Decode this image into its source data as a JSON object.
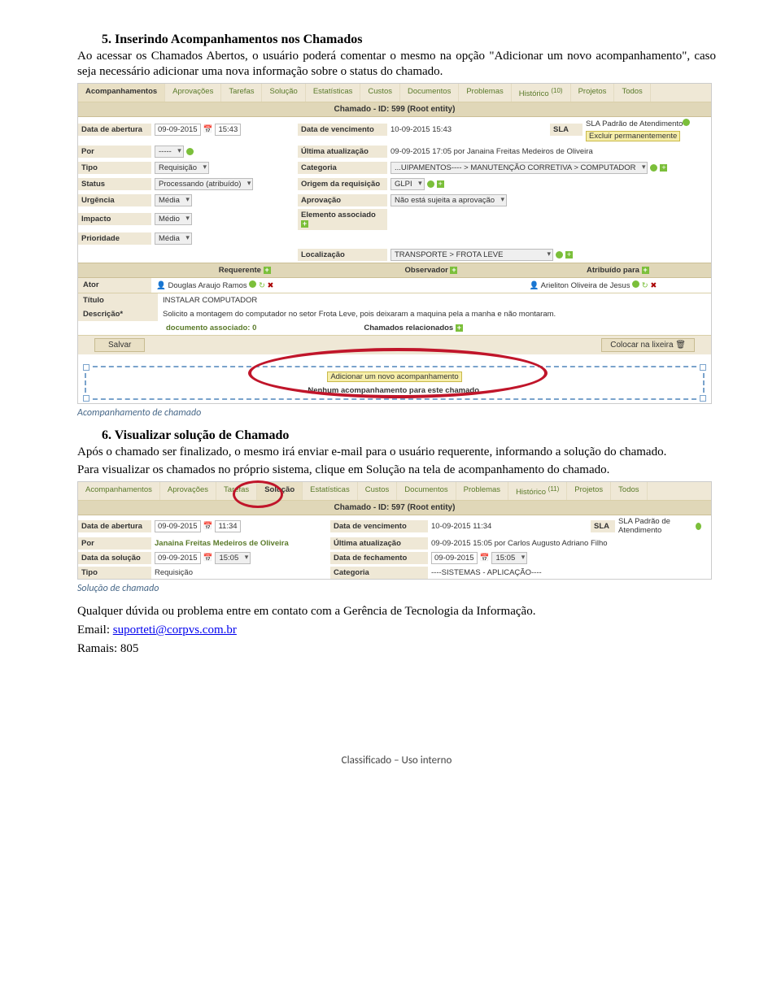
{
  "section5": {
    "heading": "5. Inserindo Acompanhamentos nos Chamados",
    "para": "Ao acessar os Chamados Abertos, o usuário poderá comentar o mesmo na opção \"Adicionar um novo acompanhamento\", caso seja necessário adicionar uma nova informação sobre o status do chamado."
  },
  "shot1": {
    "tabs": [
      "Acompanhamentos",
      "Aprovações",
      "Tarefas",
      "Solução",
      "Estatísticas",
      "Custos",
      "Documentos",
      "Problemas",
      "Histórico",
      "Projetos",
      "Todos"
    ],
    "tabs_active_index": 0,
    "historico_count": "(10)",
    "header": "Chamado - ID: 599 (Root entity)",
    "r1": {
      "l1": "Data de abertura",
      "v1_date": "09-09-2015",
      "v1_time": "15:43",
      "l2": "Data de vencimento",
      "v2": "10-09-2015 15:43",
      "l3": "SLA",
      "v3a": "SLA Padrão de Atendimento",
      "v3b": "Excluir permanentemente"
    },
    "r2": {
      "l1": "Por",
      "v1": "-----",
      "l2": "Última atualização",
      "v2": "09-09-2015 17:05 por Janaina Freitas Medeiros de Oliveira"
    },
    "r3": {
      "l1": "Tipo",
      "v1": "Requisição",
      "l2": "Categoria",
      "v2": "...UIPAMENTOS---- > MANUTENÇÃO CORRETIVA > COMPUTADOR"
    },
    "r4": {
      "l1": "Status",
      "v1": "Processando (atribuído)",
      "l2": "Origem da requisição",
      "v2": "GLPI"
    },
    "r5": {
      "l1": "Urgência",
      "v1": "Média",
      "l2": "Aprovação",
      "v2": "Não está sujeita a aprovação"
    },
    "r6": {
      "l1": "Impacto",
      "v1": "Médio",
      "l2": "Elemento associado"
    },
    "r7": {
      "l1": "Prioridade",
      "v1": "Média"
    },
    "r8": {
      "l2": "Localização",
      "v2": "TRANSPORTE > FROTA LEVE"
    },
    "actors": {
      "label": "Ator",
      "c1": "Requerente",
      "c2": "Observador",
      "c3": "Atribuído para",
      "req": "Douglas Araujo Ramos",
      "att": "Arieliton Oliveira de Jesus"
    },
    "title_row": {
      "l": "Título",
      "v": "INSTALAR COMPUTADOR"
    },
    "desc_row": {
      "l": "Descrição*",
      "v": "Solicito a montagem do computador no setor Frota Leve, pois deixaram a maquina pela a manha e não montaram."
    },
    "doc_link": "documento associado: 0",
    "related": "Chamados relacionados",
    "save": "Salvar",
    "trash": "Colocar na lixeira",
    "add_followup": "Adicionar um novo acompanhamento",
    "no_followup": "Nenhum acompanhamento para este chamado."
  },
  "caption1": "Acompanhamento de chamado",
  "section6": {
    "heading": "6. Visualizar solução de Chamado",
    "para1": "Após o chamado ser finalizado, o mesmo irá enviar e-mail para o usuário requerente, informando a solução do chamado.",
    "para2": "Para visualizar os chamados no próprio sistema, clique em Solução na tela de acompanhamento do chamado."
  },
  "shot2": {
    "tabs": [
      "Acompanhamentos",
      "Aprovações",
      "Tarefas",
      "Solução",
      "Estatísticas",
      "Custos",
      "Documentos",
      "Problemas",
      "Histórico",
      "Projetos",
      "Todos"
    ],
    "tabs_active_index": 3,
    "historico_count": "(11)",
    "header": "Chamado - ID: 597 (Root entity)",
    "r1": {
      "l1": "Data de abertura",
      "v1_date": "09-09-2015",
      "v1_time": "11:34",
      "l2": "Data de vencimento",
      "v2": "10-09-2015 11:34",
      "l3": "SLA",
      "v3": "SLA Padrão de Atendimento"
    },
    "r2": {
      "l1": "Por",
      "v1": "Janaina Freitas Medeiros de Oliveira",
      "l2": "Última atualização",
      "v2": "09-09-2015 15:05 por Carlos Augusto Adriano Filho"
    },
    "r3": {
      "l1": "Data da solução",
      "v1_date": "09-09-2015",
      "v1_time": "15:05",
      "l2": "Data de fechamento",
      "v2_date": "09-09-2015",
      "v2_time": "15:05"
    },
    "r4": {
      "l1": "Tipo",
      "v1": "Requisição",
      "l2": "Categoria",
      "v2": "----SISTEMAS - APLICAÇÃO----"
    }
  },
  "caption2": "Solução de chamado",
  "closing": {
    "line1": "Qualquer dúvida ou problema entre em contato com a Gerência de Tecnologia da Informação.",
    "email_label": "Email: ",
    "email": "suporteti@corpvs.com.br",
    "ramais": "Ramais: 805"
  },
  "footer": "Classificado – Uso interno"
}
